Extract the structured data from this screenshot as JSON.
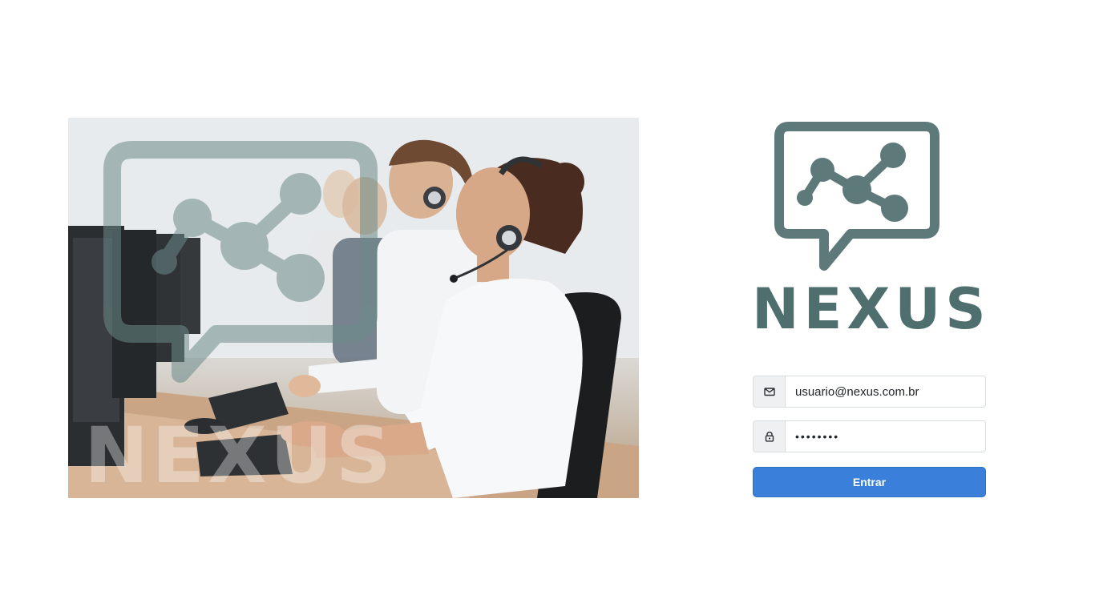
{
  "brand": {
    "name": "NEXUS",
    "watermark_name": "NEXUS",
    "logo_icon": "chat-bubble-network-icon",
    "color": "#4f6f6f"
  },
  "hero": {
    "image": "call-center-agents-with-headsets-photo"
  },
  "login": {
    "email": {
      "icon": "envelope-icon",
      "value": "usuario@nexus.com.br"
    },
    "password": {
      "icon": "lock-icon",
      "value": "••••••••"
    },
    "submit_label": "Entrar",
    "accent_color": "#3a7fd9"
  }
}
